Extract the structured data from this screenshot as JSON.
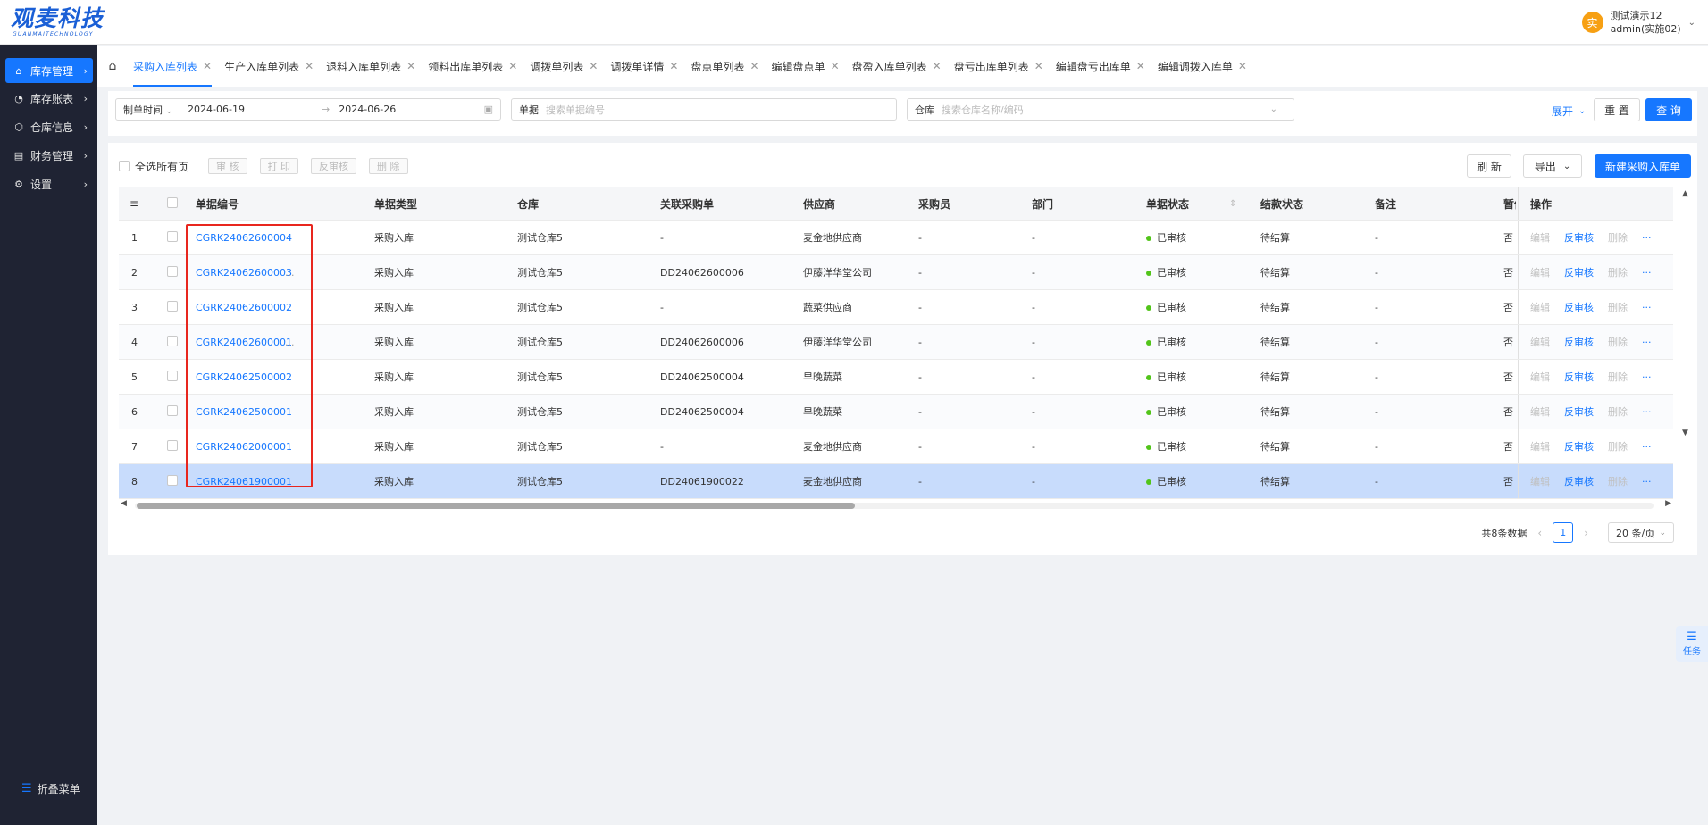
{
  "logo": {
    "main": "观麦科技",
    "sub": "GUANMAITECHNOLOGY"
  },
  "user": {
    "avatar": "实",
    "line1": "测试演示12",
    "line2": "admin(实施02)"
  },
  "sidebar": {
    "items": [
      {
        "label": "库存管理",
        "icon": "home-icon"
      },
      {
        "label": "库存账表",
        "icon": "pie-chart-icon"
      },
      {
        "label": "仓库信息",
        "icon": "cube-icon"
      },
      {
        "label": "财务管理",
        "icon": "ledger-icon"
      },
      {
        "label": "设置",
        "icon": "gear-icon"
      }
    ],
    "collapse_label": "折叠菜单"
  },
  "tabs": [
    "采购入库列表",
    "生产入库单列表",
    "退料入库单列表",
    "领料出库单列表",
    "调拨单列表",
    "调拨单详情",
    "盘点单列表",
    "编辑盘点单",
    "盘盈入库单列表",
    "盘亏出库单列表",
    "编辑盘亏出库单",
    "编辑调拨入库单"
  ],
  "filter": {
    "date_type": "制单时间",
    "date_start": "2024-06-19",
    "date_end": "2024-06-26",
    "doc_label": "单据",
    "doc_placeholder": "搜索单据编号",
    "warehouse_label": "仓库",
    "warehouse_placeholder": "搜索仓库名称/编码",
    "expand": "展开",
    "reset": "重 置",
    "search": "查 询"
  },
  "toolbar": {
    "select_all_label": "全选所有页",
    "audit": "审 核",
    "print": "打 印",
    "unaudit": "反审核",
    "delete": "删 除",
    "refresh": "刷 新",
    "export": "导出",
    "create": "新建采购入库单"
  },
  "table": {
    "headers": {
      "doc_no": "单据编号",
      "doc_type": "单据类型",
      "warehouse": "仓库",
      "po": "关联采购单",
      "supplier": "供应商",
      "buyer": "采购员",
      "dept": "部门",
      "status": "单据状态",
      "settle": "结款状态",
      "remark": "备注",
      "temp": "暂估",
      "ops": "操作"
    },
    "rows": [
      {
        "idx": "1",
        "doc_no": "CGRK24062600004",
        "doc_type": "采购入库",
        "warehouse": "测试仓库5",
        "po": "-",
        "supplier": "麦金地供应商",
        "buyer": "-",
        "dept": "-",
        "status": "已审核",
        "settle": "待结算",
        "remark": "-",
        "temp": "否",
        "ellip": ""
      },
      {
        "idx": "2",
        "doc_no": "CGRK24062600003",
        "doc_type": "采购入库",
        "warehouse": "测试仓库5",
        "po": "DD24062600006",
        "supplier": "伊藤洋华堂公司",
        "buyer": "-",
        "dept": "-",
        "status": "已审核",
        "settle": "待结算",
        "remark": "-",
        "temp": "否",
        "ellip": "..."
      },
      {
        "idx": "3",
        "doc_no": "CGRK24062600002",
        "doc_type": "采购入库",
        "warehouse": "测试仓库5",
        "po": "-",
        "supplier": "蔬菜供应商",
        "buyer": "-",
        "dept": "-",
        "status": "已审核",
        "settle": "待结算",
        "remark": "-",
        "temp": "否",
        "ellip": ""
      },
      {
        "idx": "4",
        "doc_no": "CGRK24062600001",
        "doc_type": "采购入库",
        "warehouse": "测试仓库5",
        "po": "DD24062600006",
        "supplier": "伊藤洋华堂公司",
        "buyer": "-",
        "dept": "-",
        "status": "已审核",
        "settle": "待结算",
        "remark": "-",
        "temp": "否",
        "ellip": "..."
      },
      {
        "idx": "5",
        "doc_no": "CGRK24062500002",
        "doc_type": "采购入库",
        "warehouse": "测试仓库5",
        "po": "DD24062500004",
        "supplier": "早晚蔬菜",
        "buyer": "-",
        "dept": "-",
        "status": "已审核",
        "settle": "待结算",
        "remark": "-",
        "temp": "否",
        "ellip": ""
      },
      {
        "idx": "6",
        "doc_no": "CGRK24062500001",
        "doc_type": "采购入库",
        "warehouse": "测试仓库5",
        "po": "DD24062500004",
        "supplier": "早晚蔬菜",
        "buyer": "-",
        "dept": "-",
        "status": "已审核",
        "settle": "待结算",
        "remark": "-",
        "temp": "否",
        "ellip": ""
      },
      {
        "idx": "7",
        "doc_no": "CGRK24062000001",
        "doc_type": "采购入库",
        "warehouse": "测试仓库5",
        "po": "-",
        "supplier": "麦金地供应商",
        "buyer": "-",
        "dept": "-",
        "status": "已审核",
        "settle": "待结算",
        "remark": "-",
        "temp": "否",
        "ellip": ""
      },
      {
        "idx": "8",
        "doc_no": "CGRK24061900001",
        "doc_type": "采购入库",
        "warehouse": "测试仓库5",
        "po": "DD24061900022",
        "supplier": "麦金地供应商",
        "buyer": "-",
        "dept": "-",
        "status": "已审核",
        "settle": "待结算",
        "remark": "-",
        "temp": "否",
        "ellip": ""
      }
    ],
    "ops": {
      "edit": "编辑",
      "unaudit": "反审核",
      "delete": "删除",
      "more": "···"
    },
    "selected_row": 8
  },
  "pagination": {
    "total": "共8条数据",
    "page": "1",
    "size": "20 条/页"
  },
  "task_float": "任务",
  "colors": {
    "primary": "#1677ff",
    "sidebar": "#1f2333",
    "success": "#52c41a",
    "highlight": "#e8261e"
  }
}
